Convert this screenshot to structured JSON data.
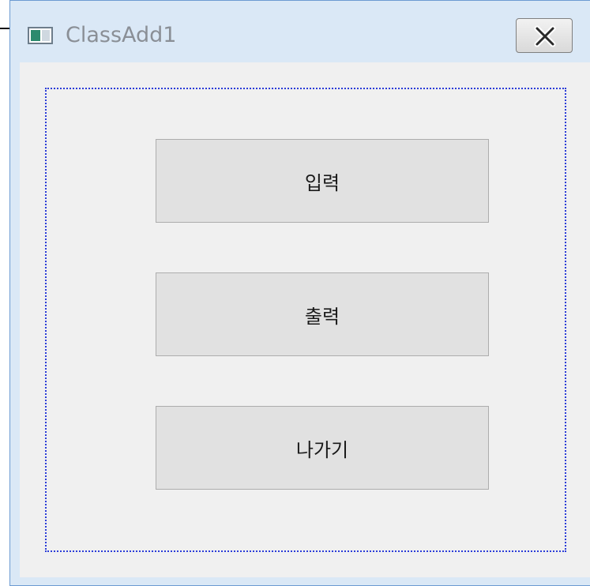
{
  "window": {
    "title": "ClassAdd1"
  },
  "buttons": {
    "input_label": "입력",
    "output_label": "출력",
    "exit_label": "나가기"
  },
  "icons": {
    "app": "application-window-icon",
    "close": "close-icon"
  },
  "colors": {
    "frame_accent": "#2b3cd8",
    "button_bg": "#e1e1e1",
    "client_bg": "#f0f0f0",
    "window_chrome": "#dae8f6"
  }
}
